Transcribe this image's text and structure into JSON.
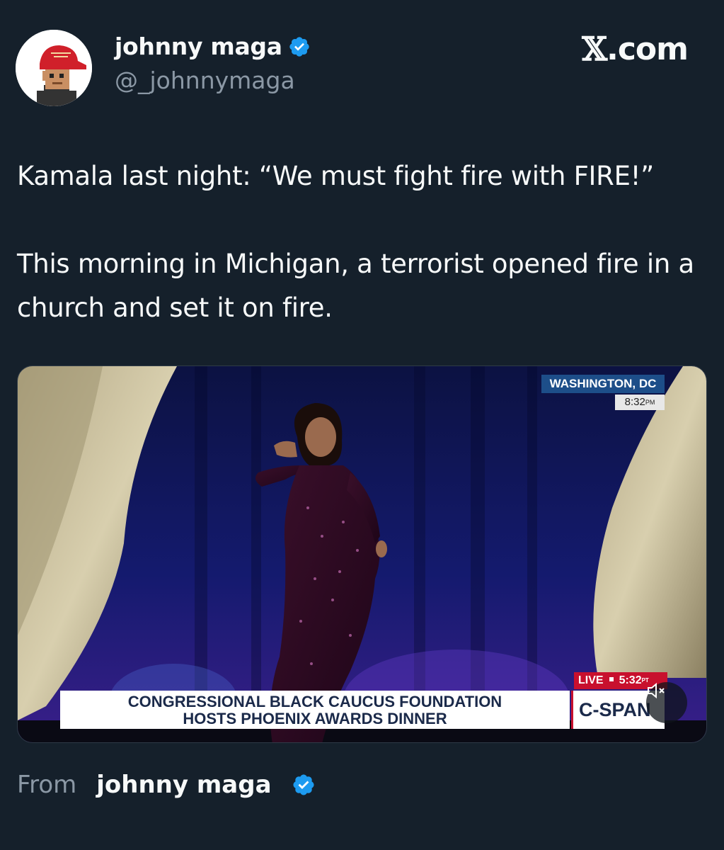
{
  "author": {
    "display_name": "johnny maga",
    "handle": "@_johnnymaga",
    "verified_icon": "verified-badge-icon",
    "avatar_icon": "pixel-avatar-red-cap-icon"
  },
  "brand": {
    "label": ".com",
    "logo_icon": "x-logo-icon",
    "logo_glyph": "𝕏"
  },
  "tweet": {
    "paragraph_1": "Kamala last night: “We must fight fire with FIRE!”",
    "paragraph_2": "This morning in Michigan, a terrorist opened fire in a church and set it on fire."
  },
  "video": {
    "location": "WASHINGTON, DC",
    "local_time": "8:32",
    "local_time_suffix": "PM",
    "live_label": "LIVE",
    "live_time": "5:32",
    "live_time_suffix": "PT",
    "headline_line1": "CONGRESSIONAL BLACK CAUCUS FOUNDATION",
    "headline_line2": "HOSTS PHOENIX AWARDS DINNER",
    "network": "C-SPAN",
    "mute_icon": "speaker-muted-icon"
  },
  "footer": {
    "from_label": "From",
    "from_name": "johnny maga"
  },
  "colors": {
    "background": "#15202b",
    "text_primary": "#f7f9f9",
    "text_secondary": "#8b98a5",
    "verified_blue": "#1d9bf0",
    "cspan_red": "#c8102e"
  }
}
